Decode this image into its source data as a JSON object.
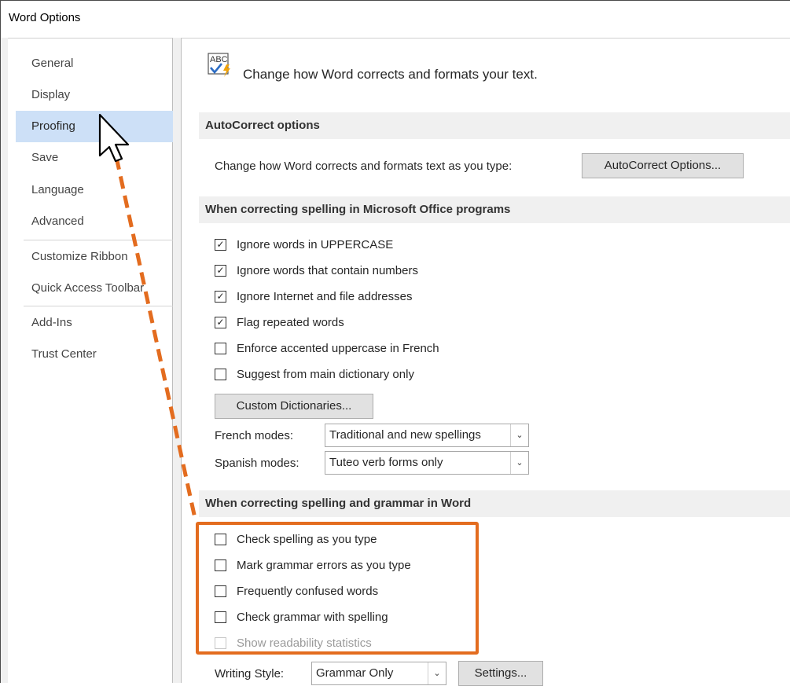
{
  "window": {
    "title": "Word Options"
  },
  "nav": {
    "items": [
      {
        "label": "General",
        "active": false
      },
      {
        "label": "Display",
        "active": false
      },
      {
        "label": "Proofing",
        "active": true
      },
      {
        "label": "Save",
        "active": false
      },
      {
        "label": "Language",
        "active": false
      },
      {
        "label": "Advanced",
        "active": false
      },
      {
        "label": "Customize Ribbon",
        "active": false
      },
      {
        "label": "Quick Access Toolbar",
        "active": false
      },
      {
        "label": "Add-Ins",
        "active": false
      },
      {
        "label": "Trust Center",
        "active": false
      }
    ]
  },
  "header": {
    "icon": "abc-check-icon",
    "icon_text": "ABC",
    "text": "Change how Word corrects and formats your text."
  },
  "autocorrect": {
    "title": "AutoCorrect options",
    "description": "Change how Word corrects and formats text as you type:",
    "button_label": "AutoCorrect Options..."
  },
  "office_spelling": {
    "title": "When correcting spelling in Microsoft Office programs",
    "options": [
      {
        "label": "Ignore words in UPPERCASE",
        "checked": true,
        "disabled": false
      },
      {
        "label": "Ignore words that contain numbers",
        "checked": true,
        "disabled": false
      },
      {
        "label": "Ignore Internet and file addresses",
        "checked": true,
        "disabled": false
      },
      {
        "label": "Flag repeated words",
        "checked": true,
        "disabled": false
      },
      {
        "label": "Enforce accented uppercase in French",
        "checked": false,
        "disabled": false
      },
      {
        "label": "Suggest from main dictionary only",
        "checked": false,
        "disabled": false
      }
    ],
    "custom_dict_button": "Custom Dictionaries...",
    "french_modes": {
      "label": "French modes:",
      "value": "Traditional and new spellings"
    },
    "spanish_modes": {
      "label": "Spanish modes:",
      "value": "Tuteo verb forms only"
    }
  },
  "word_spelling": {
    "title": "When correcting spelling and grammar in Word",
    "options": [
      {
        "label": "Check spelling as you type",
        "checked": false,
        "disabled": false
      },
      {
        "label": "Mark grammar errors as you type",
        "checked": false,
        "disabled": false
      },
      {
        "label": "Frequently confused words",
        "checked": false,
        "disabled": false
      },
      {
        "label": "Check grammar with spelling",
        "checked": false,
        "disabled": false
      },
      {
        "label": "Show readability statistics",
        "checked": false,
        "disabled": true
      }
    ],
    "writing_style": {
      "label": "Writing Style:",
      "value": "Grammar Only"
    },
    "settings_button": "Settings..."
  },
  "annotation": {
    "highlight_color": "#e36c1f",
    "cursor_icon": "mouse-pointer-icon"
  },
  "colors": {
    "nav_active": "#cde0f7",
    "section_bg": "#f0f0f0",
    "check_color": "#222222"
  }
}
